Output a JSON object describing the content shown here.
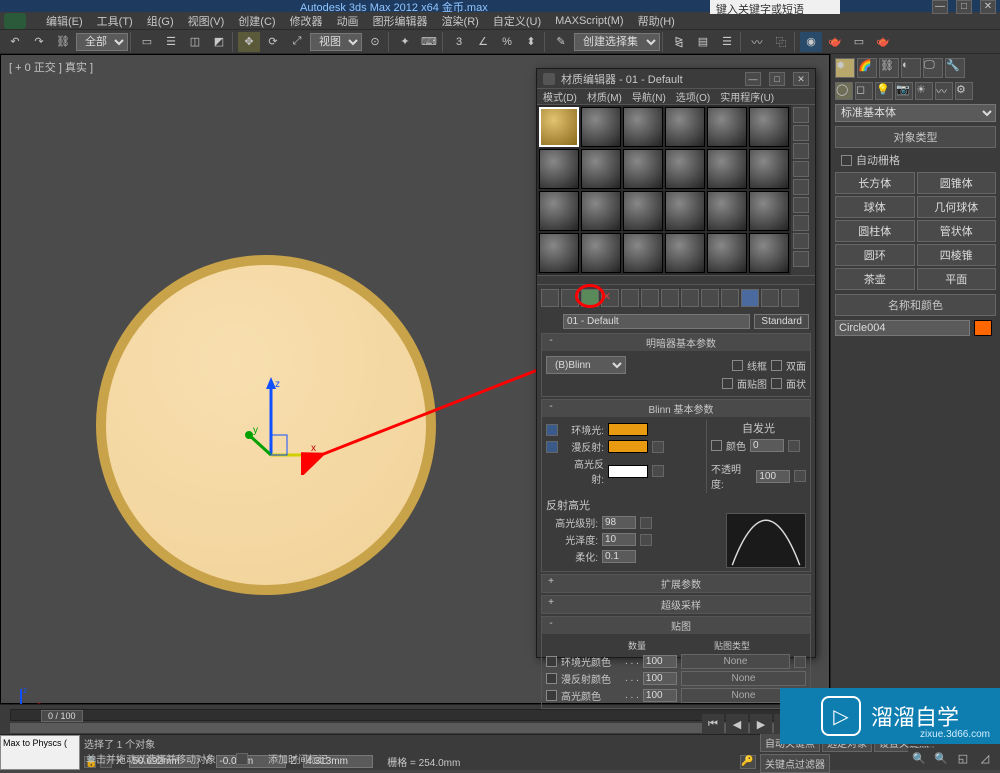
{
  "app": {
    "title": "Autodesk 3ds Max  2012 x64  金币.max",
    "help_placeholder": "键入关键字或短语"
  },
  "menu": [
    "编辑(E)",
    "工具(T)",
    "组(G)",
    "视图(V)",
    "创建(C)",
    "修改器",
    "动画",
    "图形编辑器",
    "渲染(R)",
    "自定义(U)",
    "MAXScript(M)",
    "帮助(H)"
  ],
  "toolbar": {
    "all_dropdown": "全部",
    "view_dropdown": "视图",
    "select_set": "创建选择集"
  },
  "viewport": {
    "label": "[ + 0 正交 ] 真实 ]"
  },
  "command_panel": {
    "primitive_dd": "标准基本体",
    "obj_type_title": "对象类型",
    "autogrid": "自动栅格",
    "primitives": [
      [
        "长方体",
        "圆锥体"
      ],
      [
        "球体",
        "几何球体"
      ],
      [
        "圆柱体",
        "管状体"
      ],
      [
        "圆环",
        "四棱锥"
      ],
      [
        "茶壶",
        "平面"
      ]
    ],
    "name_color_title": "名称和颜色",
    "obj_name": "Circle004"
  },
  "mat_editor": {
    "title": "材质编辑器 - 01 - Default",
    "menu": [
      "模式(D)",
      "材质(M)",
      "导航(N)",
      "选项(O)",
      "实用程序(U)"
    ],
    "mat_name": "01 - Default",
    "standard_btn": "Standard",
    "shader_rollout": "明暗器基本参数",
    "shader_dd": "(B)Blinn",
    "wire": "线框",
    "two_sided": "双面",
    "face_map": "面贴图",
    "faceted": "面状",
    "blinn_rollout": "Blinn 基本参数",
    "ambient_lbl": "环境光:",
    "diffuse_lbl": "漫反射:",
    "specular_lbl": "高光反射:",
    "self_illum_lbl": "自发光",
    "color_cb": "颜色",
    "self_illum_val": "0",
    "opacity_lbl": "不透明度:",
    "opacity_val": "100",
    "spec_hl_lbl": "反射高光",
    "spec_level_lbl": "高光级别:",
    "spec_level_val": "98",
    "gloss_lbl": "光泽度:",
    "gloss_val": "10",
    "soften_lbl": "柔化:",
    "soften_val": "0.1",
    "ext_rollout": "扩展参数",
    "super_rollout": "超级采样",
    "maps_rollout": "贴图",
    "qty_hdr": "数量",
    "maptype_hdr": "贴图类型",
    "map_rows": [
      {
        "name": "环境光颜色",
        "val": "100",
        "btn": "None"
      },
      {
        "name": "漫反射颜色",
        "val": "100",
        "btn": "None"
      },
      {
        "name": "高光颜色",
        "val": "100",
        "btn": "None"
      }
    ]
  },
  "timeline": {
    "slider_label": "0 / 100"
  },
  "status": {
    "left_btn": "Max to Physcs (",
    "prompt1": "选择了 1 个对象",
    "prompt2": "单击并拖动以选择并移动对象",
    "x": "50.692mm",
    "y": "-0.0mm",
    "z": "4.313mm",
    "grid": "栅格 = 254.0mm",
    "autokey": "自动关键点",
    "selected": "选定对象",
    "setkey": "设置关键点",
    "keyfilter": "关键点过滤器",
    "addmark": "添加时间标记"
  },
  "watermark": {
    "text": "溜溜自学",
    "url": "zixue.3d66.com"
  }
}
